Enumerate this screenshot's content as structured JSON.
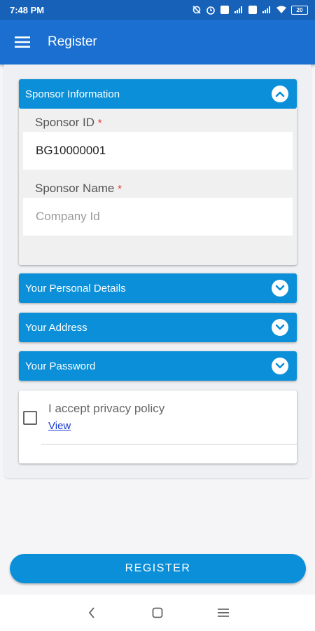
{
  "status_bar": {
    "time": "7:48 PM",
    "battery": "20"
  },
  "app_bar": {
    "title": "Register"
  },
  "sponsor_section": {
    "header": "Sponsor Information",
    "sponsor_id_label": "Sponsor ID",
    "sponsor_id_value": "BG10000001",
    "sponsor_name_label": "Sponsor Name",
    "sponsor_name_placeholder": "Company Id",
    "required_mark": "*"
  },
  "sections": [
    {
      "header": "Your Personal Details"
    },
    {
      "header": "Your Address"
    },
    {
      "header": "Your Password"
    }
  ],
  "privacy": {
    "text": "I accept privacy policy",
    "link": "View"
  },
  "register_button": "REGISTER",
  "colors": {
    "status_bar": "#1762b8",
    "app_bar": "#1a6fd0",
    "section_header": "#0a8fd8",
    "required": "#e53935",
    "link": "#1a3ccf"
  }
}
